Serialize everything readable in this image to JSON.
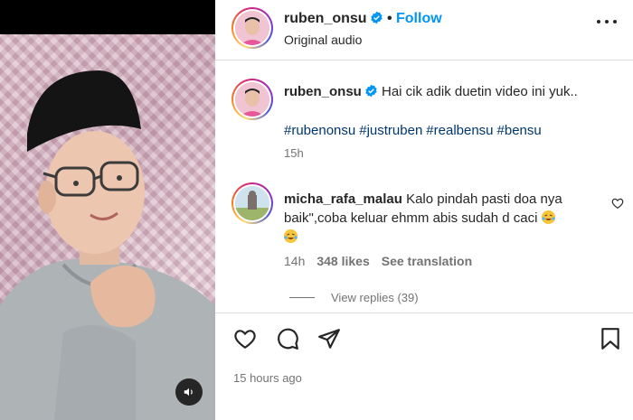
{
  "post": {
    "author": "ruben_onsu",
    "separator": "•",
    "follow_label": "Follow",
    "audio_label": "Original audio",
    "more_icon": "more-horizontal-icon",
    "media_sound_icon": "volume-icon"
  },
  "caption": {
    "author": "ruben_onsu",
    "text": "Hai cik adik duetin video ini yuk..",
    "hashtags": [
      "#rubenonsu",
      "#justruben",
      "#realbensu",
      "#bensu"
    ],
    "time": "15h"
  },
  "comment": {
    "author": "micha_rafa_malau",
    "text": "Kalo pindah pasti doa nya baik\",coba keluar ehmm abis sudah d caci",
    "emoji": "laughing-crying-emoji",
    "time": "14h",
    "likes": "348 likes",
    "see_translation": "See translation",
    "view_replies": "View replies (39)"
  },
  "footer": {
    "posted_ago": "15 hours ago"
  },
  "colors": {
    "accent": "#0095f6",
    "verified": "#0095f6",
    "hashtag": "#00376b",
    "meta": "#737373"
  }
}
